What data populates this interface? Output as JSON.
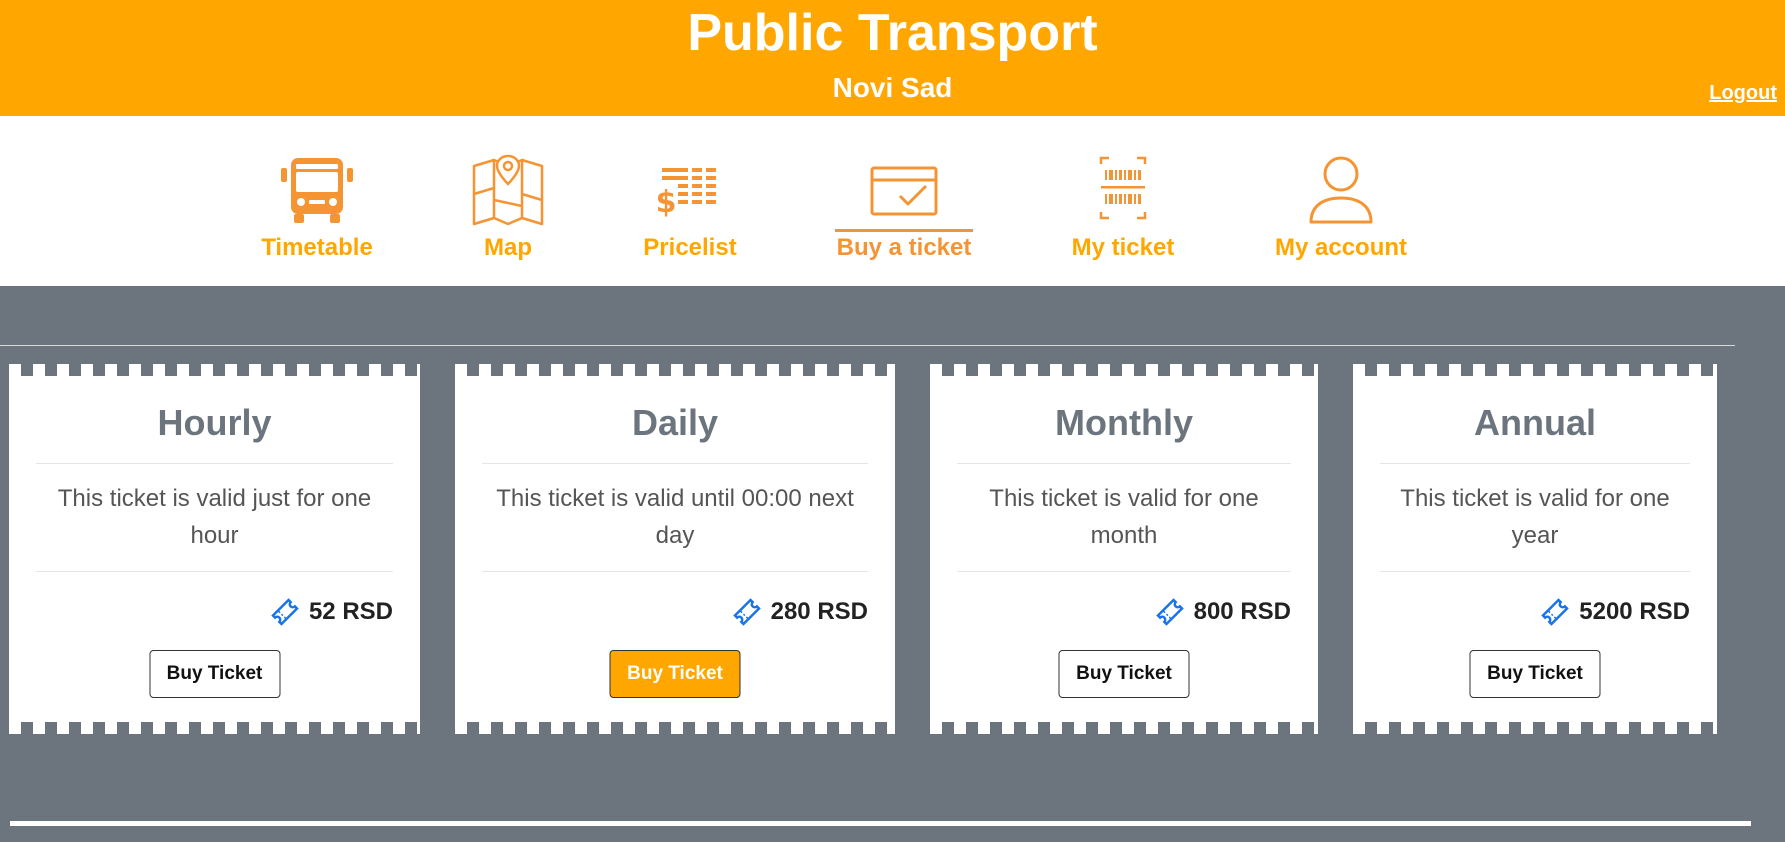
{
  "header": {
    "title": "Public Transport",
    "subtitle": "Novi Sad",
    "logout_label": "Logout"
  },
  "nav": {
    "items": [
      {
        "label": "Timetable",
        "icon": "bus-icon"
      },
      {
        "label": "Map",
        "icon": "map-pin-icon"
      },
      {
        "label": "Pricelist",
        "icon": "pricelist-icon"
      },
      {
        "label": "Buy a ticket",
        "icon": "ticket-check-icon",
        "active": true
      },
      {
        "label": "My ticket",
        "icon": "barcode-icon"
      },
      {
        "label": "My account",
        "icon": "user-icon"
      }
    ]
  },
  "tickets": [
    {
      "title": "Hourly",
      "description": "This ticket is valid just for one hour",
      "price": "52 RSD",
      "button_label": "Buy Ticket"
    },
    {
      "title": "Daily",
      "description": "This ticket is valid until 00:00 next day",
      "price": "280 RSD",
      "button_label": "Buy Ticket",
      "highlighted": true
    },
    {
      "title": "Monthly",
      "description": "This ticket is valid for one month",
      "price": "800 RSD",
      "button_label": "Buy Ticket"
    },
    {
      "title": "Annual",
      "description": "This ticket is valid for one year",
      "price": "5200 RSD",
      "button_label": "Buy Ticket"
    }
  ],
  "colors": {
    "accent": "#ffa600",
    "icon": "#f59433",
    "background": "#6c757d",
    "price_icon": "#1a73e8"
  }
}
